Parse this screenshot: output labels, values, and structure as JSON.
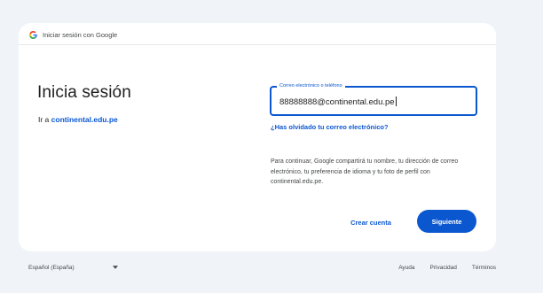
{
  "header": {
    "title": "Iniciar sesión con Google"
  },
  "main": {
    "title": "Inicia sesión",
    "subtitle_prefix": "Ir a",
    "subtitle_domain": "continental.edu.pe"
  },
  "form": {
    "email_label": "Correo electrónico o teléfono",
    "email_value": "88888888@continental.edu.pe",
    "forgot_link": "¿Has olvidado tu correo electrónico?",
    "info_text": "Para continuar, Google compartirá tu nombre, tu dirección de correo electrónico, tu preferencia de idioma y tu foto de perfil con continental.edu.pe."
  },
  "actions": {
    "create_account": "Crear cuenta",
    "next": "Siguiente"
  },
  "footer": {
    "language": "Español (España)",
    "links": [
      "Ayuda",
      "Privacidad",
      "Términos"
    ]
  },
  "colors": {
    "accent": "#0b57d0",
    "background": "#f0f4f9",
    "card": "#ffffff"
  },
  "icons": {
    "logo": "google-g-icon",
    "language_dropdown": "chevron-down-icon"
  }
}
